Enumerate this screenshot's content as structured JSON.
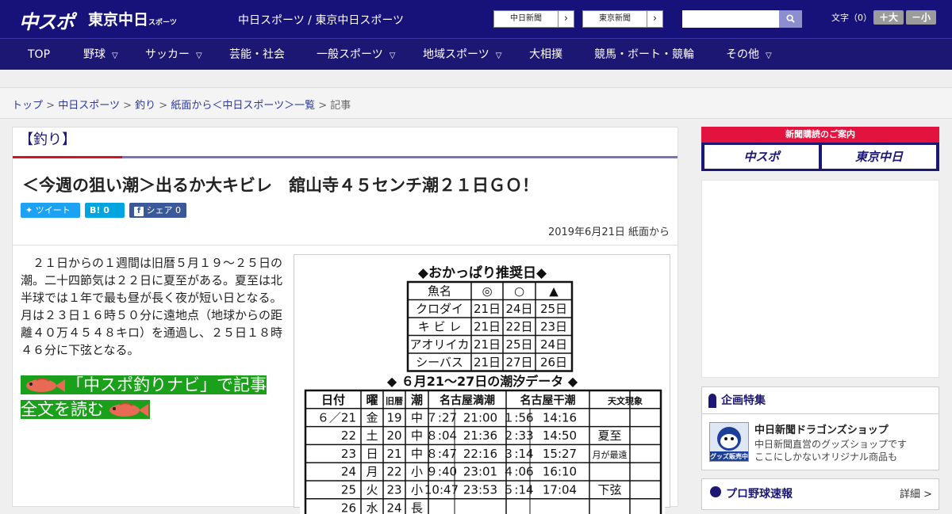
{
  "header": {
    "logo_chuspo": "中スポ",
    "logo_tokyo": "東京中日",
    "logo_tokyo_sub": "スポーツ",
    "site_names": "中日スポーツ / 東京中日スポーツ",
    "btn_chunichi": "中日新聞",
    "btn_tokyo": "東京新聞",
    "btn_arrow": "›",
    "search_placeholder": "",
    "font_label": "文字（0）",
    "font_large": "＋大",
    "font_small": "－小"
  },
  "nav": {
    "items": [
      "TOP",
      "野球",
      "サッカー",
      "芸能・社会",
      "一般スポーツ",
      "地域スポーツ",
      "大相撲",
      "競馬・ボート・競輪",
      "その他"
    ],
    "chevron": "⌄"
  },
  "breadcrumb": {
    "items": [
      "トップ",
      "中日スポーツ",
      "釣り",
      "紙面から＜中日スポーツ＞一覧"
    ],
    "separator": ">",
    "current": "記事"
  },
  "article": {
    "category": "【釣り】",
    "headline": "＜今週の狙い潮＞出るか大キビレ　舘山寺４５センチ潮２１日ＧＯ！",
    "share_tweet": "ツイート",
    "share_hatena": "B! 0",
    "share_fb": "シェア 0",
    "date": "2019年6月21日 紙面から",
    "body": "　２１日からの１週間は旧暦５月１９～２５日の潮。二十四節気は２２日に夏至がある。夏至は北半球では１年で最も昼が長く夜が短い日となる。月は２３日１６時５０分に遠地点（地球からの距離４０万４５４８キロ）を通過し、２５日１８時４６分に下弦となる。",
    "navi_link": "「中スポ釣りナビ」で記事全文を読む"
  },
  "recommend_table": {
    "title": "◆おかっぱり推奨日◆",
    "headers": [
      "魚名",
      "◎",
      "○",
      "▲"
    ],
    "rows": [
      [
        "クロダイ",
        "21日",
        "24日",
        "25日"
      ],
      [
        "キ ビ レ",
        "21日",
        "22日",
        "23日"
      ],
      [
        "アオリイカ",
        "21日",
        "25日",
        "24日"
      ],
      [
        "シーバス",
        "21日",
        "27日",
        "26日"
      ]
    ]
  },
  "tide_table": {
    "title": "◆ ６月21～27日の潮汐データ ◆",
    "headers": [
      "日付",
      "曜",
      "旧暦",
      "潮",
      "名古屋満潮",
      "名古屋干潮",
      "天文現象"
    ],
    "rows": [
      [
        "６／21",
        "金",
        "19",
        "中",
        "７:27",
        "21:00",
        "１:56",
        "14:16",
        ""
      ],
      [
        "22",
        "土",
        "20",
        "中",
        "８:04",
        "21:36",
        "２:33",
        "14:50",
        "夏至"
      ],
      [
        "23",
        "日",
        "21",
        "中",
        "８:47",
        "22:16",
        "３:14",
        "15:27",
        "月が最遠"
      ],
      [
        "24",
        "月",
        "22",
        "小",
        "９:40",
        "23:01",
        "４:06",
        "16:10",
        ""
      ],
      [
        "25",
        "火",
        "23",
        "小",
        "10:47",
        "23:53",
        "５:14",
        "17:04",
        "下弦"
      ],
      [
        "26",
        "水",
        "24",
        "長",
        "",
        "",
        "",
        "",
        ""
      ]
    ]
  },
  "sidebar": {
    "ad_banner": "新聞購読のご案内",
    "ad_chuspo": "中スポ",
    "ad_tokyo": "東京中日",
    "feature_title": "企画特集",
    "feature_item_title": "中日新聞ドラゴンズショップ",
    "feature_item_desc1": "中日新聞直営のグッズショップです",
    "feature_item_desc2": "ここにしかないオリジナル商品も",
    "feature_thumb_text": "グッズ販売中",
    "baseball_title": "プロ野球速報",
    "baseball_more": "詳細 >"
  },
  "colors": {
    "brand_navy": "#17127a",
    "accent_red": "#d2142a",
    "navi_green": "#1aa01a",
    "twitter": "#1da1f2",
    "hatena": "#00a4de",
    "facebook": "#3b5998"
  }
}
